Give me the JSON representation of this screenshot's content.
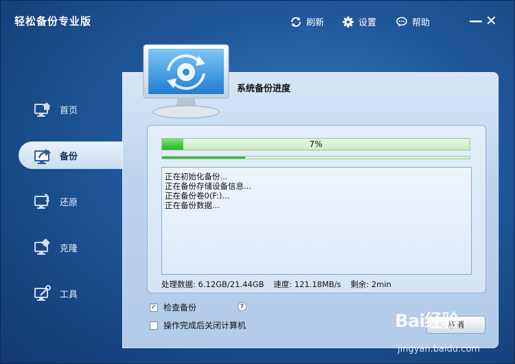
{
  "app": {
    "title": "轻松备份专业版"
  },
  "toolbar": {
    "refresh_label": "刷新",
    "settings_label": "设置",
    "help_label": "帮助",
    "refresh_icon": "refresh-icon",
    "settings_icon": "gear-icon",
    "help_icon": "speech-bubble-icon"
  },
  "window_controls": {
    "minimize": "—",
    "close": "✕"
  },
  "sidebar": {
    "items": [
      {
        "label": "首页",
        "icon": "home-monitor-icon",
        "active": false
      },
      {
        "label": "备份",
        "icon": "backup-monitor-icon",
        "active": true
      },
      {
        "label": "还原",
        "icon": "restore-monitor-icon",
        "active": false
      },
      {
        "label": "克隆",
        "icon": "clone-monitor-icon",
        "active": false
      },
      {
        "label": "工具",
        "icon": "tools-monitor-icon",
        "active": false
      }
    ]
  },
  "panel": {
    "title": "系统备份进度"
  },
  "progress": {
    "main_fraction": 0.07,
    "main_text": "7%",
    "sub_fraction": 0.27
  },
  "log": {
    "lines": [
      "正在初始化备份...",
      "正在备份存储设备信息...",
      "正在备份卷0(F:)...",
      "正在备份数据..."
    ]
  },
  "stats": {
    "processed": "处理数据: 6.12GB/21.44GB",
    "speed": "速度: 121.18MB/s",
    "remaining": "剩余: 2min"
  },
  "options": {
    "verify_label": "检查备份",
    "verify_checked": true,
    "help_mark": "?",
    "shutdown_label": "操作完成后关闭计算机",
    "shutdown_checked": false
  },
  "actions": {
    "cancel_label": "取消"
  },
  "watermark": {
    "logo": "Bai经验",
    "url": "jingyan.baidu.com"
  },
  "colors": {
    "accent_green": "#27b52c",
    "panel_bg": "#c7dbf1",
    "window_bg": "#1f5699"
  }
}
